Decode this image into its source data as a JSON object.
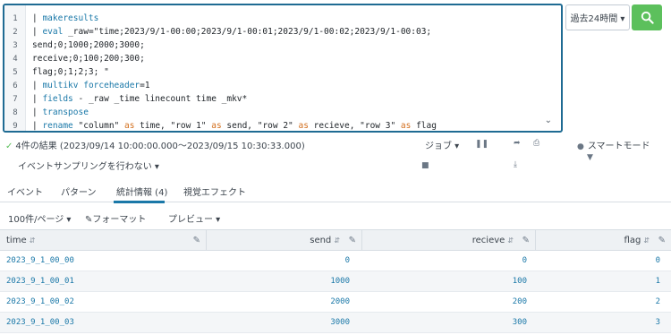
{
  "search": {
    "line_numbers": [
      "1",
      "2",
      "3",
      "4",
      "5",
      "6",
      "7",
      "8",
      "9"
    ],
    "lines": [
      "| makeresults",
      "| eval _raw=\"time;2023/9/1-00:00;2023/9/1-00:01;2023/9/1-00:02;2023/9/1-00:03;",
      "send;0;1000;2000;3000;",
      "receive;0;100;200;300;",
      "flag;0;1;2;3; \"",
      "| multikv forceheader=1",
      "| fields - _raw _time linecount time _mkv*",
      "| transpose",
      "| rename \"column\" as time, \"row 1\" as send, \"row 2\" as recieve, \"row 3\" as flag"
    ]
  },
  "timepicker": {
    "label": "過去24時間 ▾"
  },
  "status": {
    "result_text": "4件の結果 (2023/09/14 10:00:00.000〜2023/09/15 10:30:33.000)",
    "job_label": "ジョブ ▾",
    "smart_mode_label": "スマートモード",
    "sampling_label": "イベントサンプリングを行わない ▾"
  },
  "tabs": [
    {
      "label": "イベント"
    },
    {
      "label": "パターン"
    },
    {
      "label": "統計情報 (4)"
    },
    {
      "label": "視覚エフェクト"
    }
  ],
  "toolbar": {
    "per_page": "100件/ページ ▾",
    "format": "フォーマット",
    "preview": "プレビュー ▾"
  },
  "table": {
    "columns": [
      "time",
      "send",
      "recieve",
      "flag"
    ],
    "rows": [
      [
        "2023_9_1_00_00",
        "0",
        "0",
        "0"
      ],
      [
        "2023_9_1_00_01",
        "1000",
        "100",
        "1"
      ],
      [
        "2023_9_1_00_02",
        "2000",
        "200",
        "2"
      ],
      [
        "2023_9_1_00_03",
        "3000",
        "300",
        "3"
      ]
    ]
  },
  "colors": {
    "accent": "#1a78a8",
    "search_button": "#5cc05c",
    "editor_border": "#1f6b93",
    "keyword_orange": "#d3701f"
  }
}
